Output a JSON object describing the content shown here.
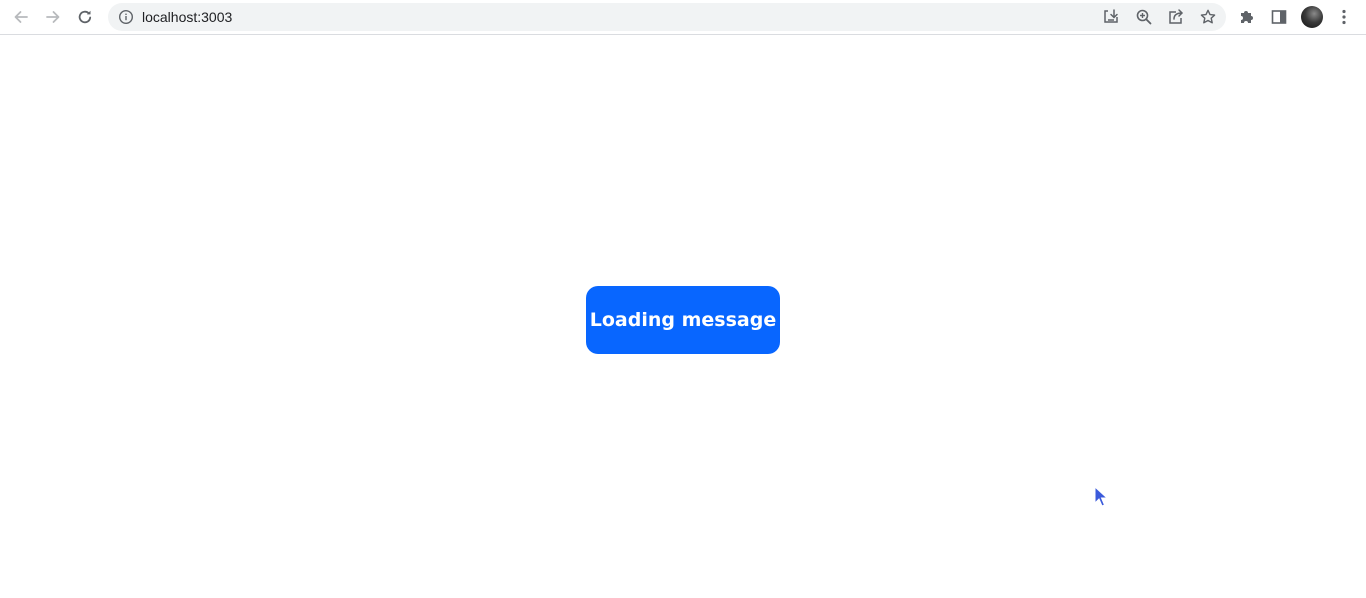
{
  "browser": {
    "url": "localhost:3003",
    "icons": {
      "back": "arrow-left-icon",
      "forward": "arrow-right-icon",
      "reload": "reload-icon",
      "site_info": "info-icon",
      "install": "install-icon",
      "zoom": "zoom-icon",
      "share": "share-icon",
      "bookmark": "star-icon",
      "extensions": "puzzle-icon",
      "side_panel": "side-panel-icon",
      "profile": "avatar",
      "menu": "kebab-menu-icon"
    }
  },
  "main": {
    "button_label": "Loading message",
    "button_color": "#0866ff"
  }
}
